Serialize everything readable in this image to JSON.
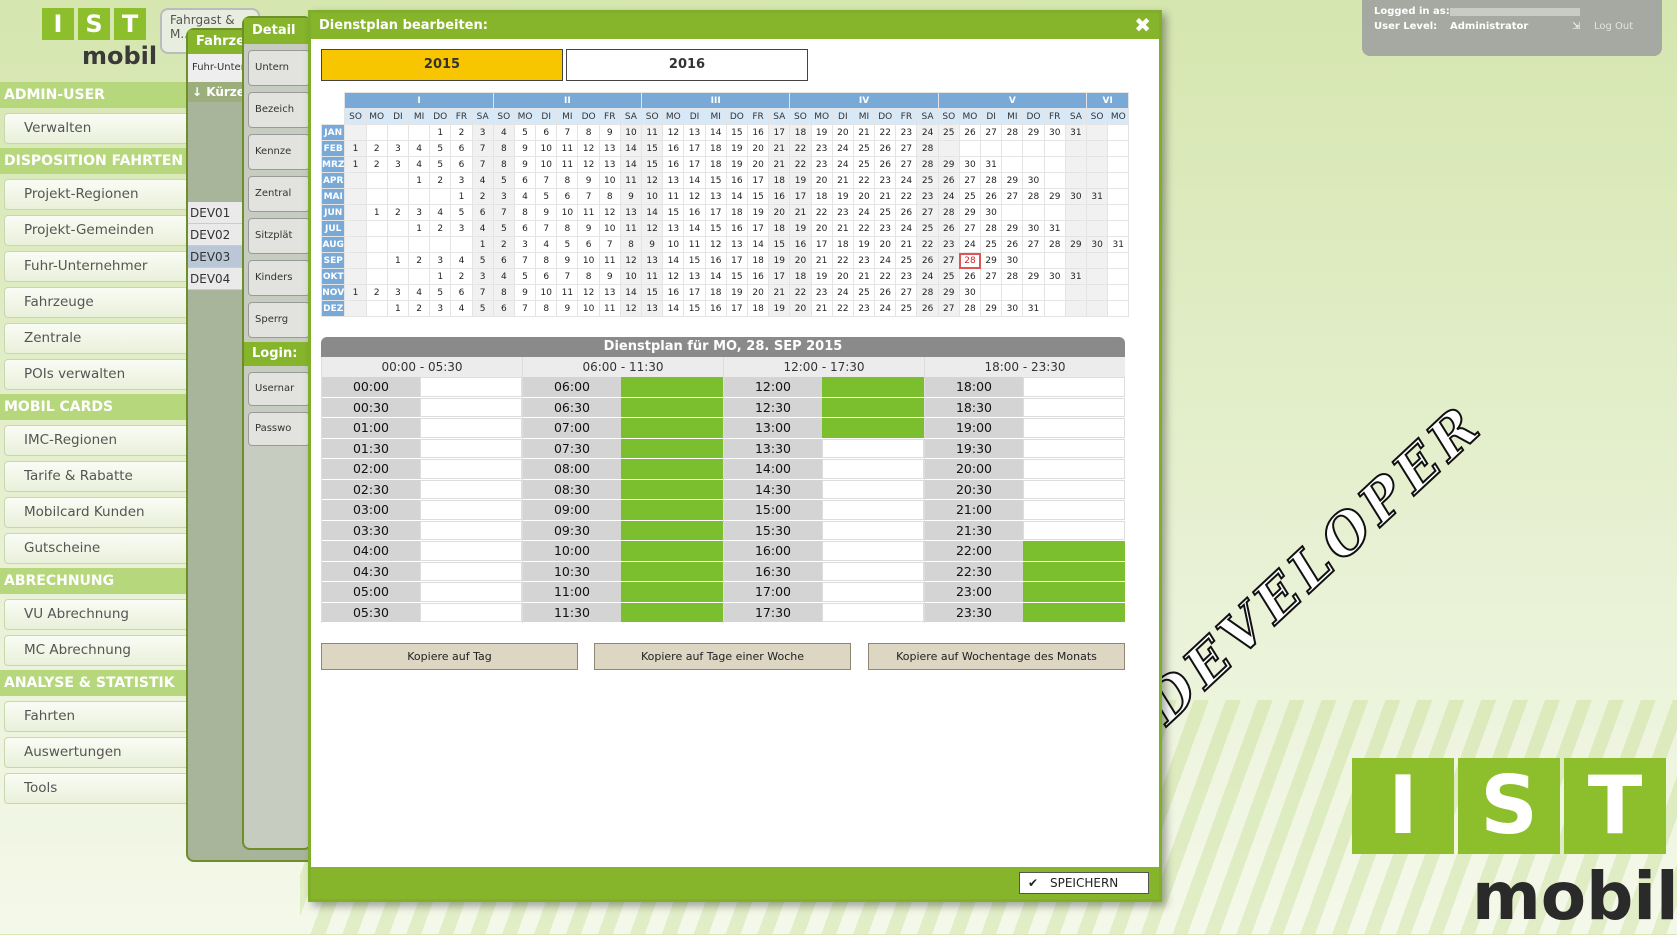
{
  "brand": {
    "letters": [
      "I",
      "S",
      "T"
    ],
    "word": "mobil"
  },
  "sidebar": {
    "sections": [
      {
        "title": "ADMIN-USER",
        "items": [
          "Verwalten"
        ]
      },
      {
        "title": "DISPOSITION FAHRTEN",
        "items": [
          "Projekt-Regionen",
          "Projekt-Gemeinden",
          "Fuhr-Unternehmer",
          "Fahrzeuge",
          "Zentrale",
          "POIs verwalten"
        ]
      },
      {
        "title": "MOBIL CARDS",
        "items": [
          "IMC-Regionen",
          "Tarife & Rabatte",
          "Mobilcard Kunden",
          "Gutscheine"
        ]
      },
      {
        "title": "ABRECHNUNG",
        "items": [
          "VU Abrechnung",
          "MC Abrechnung"
        ]
      },
      {
        "title": "ANALYSE & STATISTIK",
        "items": [
          "Fahrten",
          "Auswertungen",
          "Tools"
        ]
      }
    ]
  },
  "bg_windows": {
    "tab1": "Fahrgast & M.. M..",
    "tab2": "Fahrze",
    "tab3": "Detail",
    "col1": "Fuhr-Unter",
    "col1b": "↓ Kürzel",
    "devs": [
      "DEV01",
      "DEV02",
      "DEV03",
      "DEV04"
    ],
    "fields": [
      "Untern",
      "Bezeich",
      "Kennze",
      "Zentral",
      "Sitzplät",
      "Kinders",
      "Sperrg"
    ],
    "login": "Login:",
    "login_fields": [
      "Usernar",
      "Passwo"
    ]
  },
  "user": {
    "logged_label": "Logged in as:",
    "level_label": "User Level:",
    "level": "Administrator",
    "logout": "Log Out"
  },
  "watermark": {
    "dev_text": "DEVELOPER",
    "big_letters": [
      "I",
      "S",
      "T"
    ],
    "big_word": "mobil"
  },
  "modal": {
    "title": "Dienstplan bearbeiten:",
    "close": "✖",
    "years": [
      {
        "label": "2015",
        "active": true,
        "color": "#f7c600"
      },
      {
        "label": "2016",
        "active": false
      }
    ],
    "calendar": {
      "year": 2015,
      "month_groups": [
        "I",
        "II",
        "III",
        "IV",
        "V",
        "VI"
      ],
      "day_headers": [
        "SO",
        "MO",
        "DI",
        "MI",
        "DO",
        "FR",
        "SA",
        "SO",
        "MO",
        "DI",
        "MI",
        "DO",
        "FR",
        "SA",
        "SO",
        "MO",
        "DI",
        "MI",
        "DO",
        "FR",
        "SA",
        "SO",
        "MO",
        "DI",
        "MI",
        "DO",
        "FR",
        "SA",
        "SO",
        "MO",
        "DI",
        "MI",
        "DO",
        "FR",
        "SA",
        "SO",
        "MO"
      ],
      "months": [
        "JAN",
        "FEB",
        "MRZ",
        "APR",
        "MAI",
        "JUN",
        "JUL",
        "AUG",
        "SEP",
        "OKT",
        "NOV",
        "DEZ"
      ],
      "selected_month": "SEP",
      "selected_day": 28
    },
    "plan_title": "Dienstplan für MO, 28. SEP 2015",
    "columns": [
      {
        "range": "00:00 - 05:30",
        "slots": [
          {
            "t": "00:00",
            "on": false
          },
          {
            "t": "00:30",
            "on": false
          },
          {
            "t": "01:00",
            "on": false
          },
          {
            "t": "01:30",
            "on": false
          },
          {
            "t": "02:00",
            "on": false
          },
          {
            "t": "02:30",
            "on": false
          },
          {
            "t": "03:00",
            "on": false
          },
          {
            "t": "03:30",
            "on": false
          },
          {
            "t": "04:00",
            "on": false
          },
          {
            "t": "04:30",
            "on": false
          },
          {
            "t": "05:00",
            "on": false
          },
          {
            "t": "05:30",
            "on": false
          }
        ]
      },
      {
        "range": "06:00 - 11:30",
        "slots": [
          {
            "t": "06:00",
            "on": true
          },
          {
            "t": "06:30",
            "on": true
          },
          {
            "t": "07:00",
            "on": true
          },
          {
            "t": "07:30",
            "on": true
          },
          {
            "t": "08:00",
            "on": true
          },
          {
            "t": "08:30",
            "on": true
          },
          {
            "t": "09:00",
            "on": true
          },
          {
            "t": "09:30",
            "on": true
          },
          {
            "t": "10:00",
            "on": true
          },
          {
            "t": "10:30",
            "on": true
          },
          {
            "t": "11:00",
            "on": true
          },
          {
            "t": "11:30",
            "on": true
          }
        ]
      },
      {
        "range": "12:00 - 17:30",
        "slots": [
          {
            "t": "12:00",
            "on": true
          },
          {
            "t": "12:30",
            "on": true
          },
          {
            "t": "13:00",
            "on": true
          },
          {
            "t": "13:30",
            "on": false
          },
          {
            "t": "14:00",
            "on": false
          },
          {
            "t": "14:30",
            "on": false
          },
          {
            "t": "15:00",
            "on": false
          },
          {
            "t": "15:30",
            "on": false
          },
          {
            "t": "16:00",
            "on": false
          },
          {
            "t": "16:30",
            "on": false
          },
          {
            "t": "17:00",
            "on": false
          },
          {
            "t": "17:30",
            "on": false
          }
        ]
      },
      {
        "range": "18:00 - 23:30",
        "slots": [
          {
            "t": "18:00",
            "on": false
          },
          {
            "t": "18:30",
            "on": false
          },
          {
            "t": "19:00",
            "on": false
          },
          {
            "t": "19:30",
            "on": false
          },
          {
            "t": "20:00",
            "on": false
          },
          {
            "t": "20:30",
            "on": false
          },
          {
            "t": "21:00",
            "on": false
          },
          {
            "t": "21:30",
            "on": false
          },
          {
            "t": "22:00",
            "on": true
          },
          {
            "t": "22:30",
            "on": true
          },
          {
            "t": "23:00",
            "on": true
          },
          {
            "t": "23:30",
            "on": true
          }
        ]
      }
    ],
    "copy_buttons": [
      "Kopiere auf Tag",
      "Kopiere auf Tage einer Woche",
      "Kopiere auf Wochentage des Monats"
    ],
    "save": "SPEICHERN",
    "save_icon": "check-icon"
  },
  "colors": {
    "accent": "#86b52c",
    "slot_on": "#7cbf2e",
    "year_active": "#f7c600",
    "calendar_head": "#79a9d7"
  }
}
